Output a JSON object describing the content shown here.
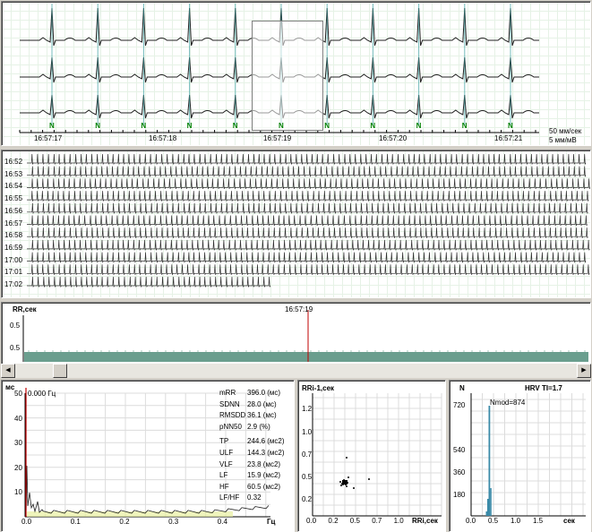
{
  "ecg_panel": {
    "times": [
      "16:57:17",
      "16:57:18",
      "16:57:19",
      "16:57:20",
      "16:57:21"
    ],
    "beat_label": "N",
    "speed": "50 мм/сек",
    "gain": "5 мм/мВ"
  },
  "trend_panel": {
    "rows": [
      "16:52",
      "16:53",
      "16:54",
      "16:55",
      "16:56",
      "16:57",
      "16:58",
      "16:59",
      "17:00",
      "17:01",
      "17:02"
    ]
  },
  "rr_panel": {
    "title": "RR,сек",
    "marker_time": "16:57:19",
    "y_tick": "0.5",
    "y_tick2": "0.5"
  },
  "spectrum_panel": {
    "y_unit": "мс",
    "freq_readout": "0.000 Гц",
    "y_ticks": [
      "50",
      "40",
      "30",
      "20",
      "10"
    ],
    "x_ticks": [
      "0.0",
      "0.1",
      "0.2",
      "0.3",
      "0.4"
    ],
    "x_unit": "Гц",
    "stats": [
      {
        "k": "mRR",
        "v": "396.0 (мс)"
      },
      {
        "k": "SDNN",
        "v": "28.0 (мс)"
      },
      {
        "k": "RMSDD",
        "v": "36.1 (мс)"
      },
      {
        "k": "pNN50",
        "v": "2.9 (%)"
      },
      {
        "k": "TP",
        "v": "244.6 (мс2)"
      },
      {
        "k": "ULF",
        "v": "144.3 (мс2)"
      },
      {
        "k": "VLF",
        "v": "23.8 (мс2)"
      },
      {
        "k": "LF",
        "v": "15.9 (мс2)"
      },
      {
        "k": "HF",
        "v": "60.5 (мс2)"
      },
      {
        "k": "LF/HF",
        "v": "0.32"
      }
    ]
  },
  "scatter_panel": {
    "title": "RRi-1,сек",
    "x_label": "RRi,сек",
    "y_ticks": [
      "1.2",
      "1.0",
      "0.7",
      "0.5",
      "0.2"
    ],
    "x_ticks": [
      "0.0",
      "0.2",
      "0.5",
      "0.7",
      "1.0"
    ]
  },
  "histogram_panel": {
    "y_label": "N",
    "title": "HRV TI=1.7",
    "nmod": "Nmod=874",
    "y_ticks": [
      "720",
      "540",
      "360",
      "180"
    ],
    "x_ticks": [
      "0.0",
      "0.5",
      "1.0",
      "1.5"
    ],
    "x_unit": "сек"
  },
  "colors": {
    "rr_fill": "#6a9e8e",
    "marker": "#c00000",
    "beat_mark": "#008000"
  }
}
